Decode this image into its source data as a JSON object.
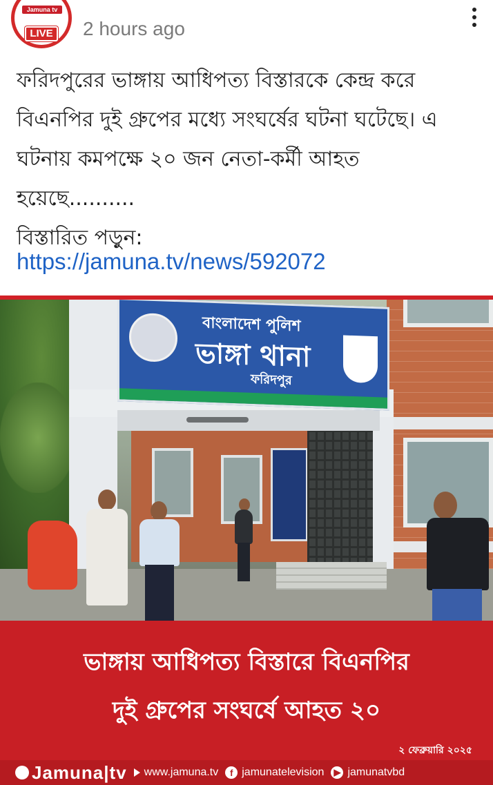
{
  "header": {
    "channel_badge": "Jamuna tv",
    "live_label": "LIVE",
    "timestamp": "2 hours ago",
    "menu_icon": "more-vertical-icon"
  },
  "post": {
    "text": "ফরিদপুরের ভাঙ্গায় আধিপত্য বিস্তারকে কেন্দ্র করে বিএনপির দুই গ্রুপের মধ্যে সংঘর্ষের ঘটনা ঘটেছে। এ ঘটনায় কমপক্ষে ২০ জন নেতা-কর্মী আহত হয়েছে..........",
    "read_more": "বিস্তারিত পড়ুন:",
    "link": "https://jamuna.tv/news/592072"
  },
  "image": {
    "sign": {
      "line1": "বাংলাদেশ পুলিশ",
      "line2": "ভাঙ্গা থানা",
      "line3": "ফরিদপুর"
    },
    "caption_line1": "ভাঙ্গায় আধিপত্য বিস্তারে বিএনপির",
    "caption_line2": "দুই গ্রুপের সংঘর্ষে আহত ২০",
    "date": "২ ফেব্রুয়ারি ২০২৫",
    "footer": {
      "logo": "Jamuna|tv",
      "website": "www.jamuna.tv",
      "facebook": "jamunatelevision",
      "youtube": "jamunatvbd"
    }
  },
  "colors": {
    "brand_red": "#c81f25",
    "link_blue": "#1f63c6",
    "timestamp_gray": "#7a7a7a"
  }
}
